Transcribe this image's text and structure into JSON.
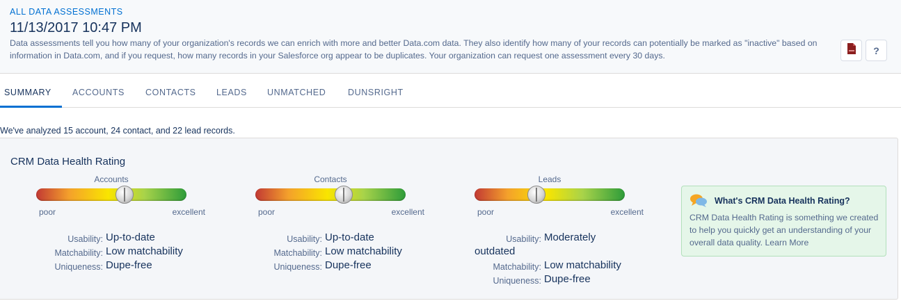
{
  "header": {
    "breadcrumb": "ALL DATA ASSESSMENTS",
    "title": "11/13/2017 10:47 PM",
    "description": "Data assessments tell you how many of your organization's records we can enrich with more and better Data.com data. They also identify how many of your records can potentially be marked as \"inactive\" based on information in Data.com, and if you request, how many records in your Salesforce org appear to be duplicates. Your organization can request one assessment every 30 days.",
    "pdf_icon": "pdf-file-icon",
    "help_label": "?"
  },
  "tabs": [
    {
      "label": "SUMMARY",
      "active": true
    },
    {
      "label": "ACCOUNTS",
      "active": false
    },
    {
      "label": "CONTACTS",
      "active": false
    },
    {
      "label": "LEADS",
      "active": false
    },
    {
      "label": "UNMATCHED",
      "active": false
    },
    {
      "label": "DUNSRIGHT",
      "active": false
    }
  ],
  "summary": {
    "analyzed_text": "We've analyzed 15 account, 24 contact, and 22 lead records.",
    "panel_title": "CRM Data Health Rating",
    "gauges": [
      {
        "label": "Accounts",
        "poor": "poor",
        "excellent": "excellent",
        "rating": 0.59,
        "usability_key": "Usability:",
        "usability": "Up-to-date",
        "matchability_key": "Matchability:",
        "matchability": "Low matchability",
        "uniqueness_key": "Uniqueness:",
        "uniqueness": "Dupe-free"
      },
      {
        "label": "Contacts",
        "poor": "poor",
        "excellent": "excellent",
        "rating": 0.59,
        "usability_key": "Usability:",
        "usability": "Up-to-date",
        "matchability_key": "Matchability:",
        "matchability": "Low matchability",
        "uniqueness_key": "Uniqueness:",
        "uniqueness": "Dupe-free"
      },
      {
        "label": "Leads",
        "poor": "poor",
        "excellent": "excellent",
        "rating": 0.41,
        "usability_key": "Usability:",
        "usability": "Moderately",
        "usability_cont": "outdated",
        "matchability_key": "Matchability:",
        "matchability": "Low matchability",
        "uniqueness_key": "Uniqueness:",
        "uniqueness": "Dupe-free"
      }
    ],
    "info": {
      "icon": "chat-bubbles-icon",
      "title": "What's CRM Data Health Rating?",
      "text": "CRM Data Health Rating is something we created to help you quickly get an understanding of your overall data quality.",
      "link": "Learn More"
    }
  },
  "colors": {
    "accent": "#0070d2",
    "text": "#16325c",
    "muted": "#54698d",
    "info_bg": "#e5f6e9"
  }
}
